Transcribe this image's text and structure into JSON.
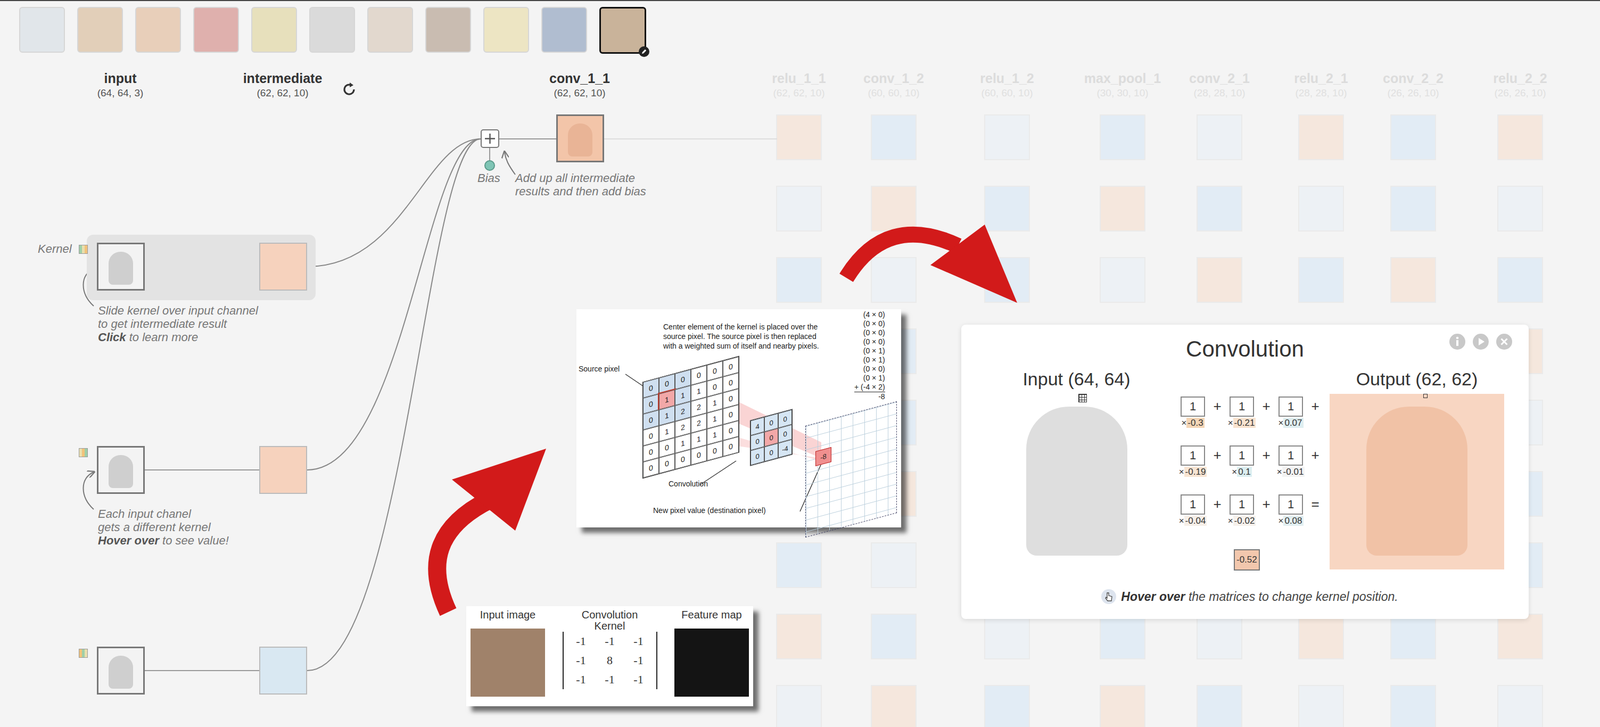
{
  "thumbnails": [
    {
      "selected": false
    },
    {
      "selected": false
    },
    {
      "selected": false
    },
    {
      "selected": false
    },
    {
      "selected": false
    },
    {
      "selected": false
    },
    {
      "selected": false
    },
    {
      "selected": false
    },
    {
      "selected": false
    },
    {
      "selected": false
    },
    {
      "selected": true
    }
  ],
  "layers": [
    {
      "name": "input",
      "shape": "(64, 64, 3)",
      "faded": false
    },
    {
      "name": "intermediate",
      "shape": "(62, 62, 10)",
      "faded": false
    },
    {
      "name": "conv_1_1",
      "shape": "(62, 62, 10)",
      "faded": false
    },
    {
      "name": "relu_1_1",
      "shape": "(62, 62, 10)",
      "faded": true
    },
    {
      "name": "conv_1_2",
      "shape": "(60, 60, 10)",
      "faded": true
    },
    {
      "name": "relu_1_2",
      "shape": "(60, 60, 10)",
      "faded": true
    },
    {
      "name": "max_pool_1",
      "shape": "(30, 30, 10)",
      "faded": true
    },
    {
      "name": "conv_2_1",
      "shape": "(28, 28, 10)",
      "faded": true
    },
    {
      "name": "relu_2_1",
      "shape": "(28, 28, 10)",
      "faded": true
    },
    {
      "name": "conv_2_2",
      "shape": "(26, 26, 10)",
      "faded": true
    },
    {
      "name": "relu_2_2",
      "shape": "(26, 26, 10)",
      "faded": true
    }
  ],
  "kernel_label": "Kernel",
  "kernel_rows": [
    {
      "highlighted": true,
      "color": "#f6d2bd"
    },
    {
      "highlighted": false,
      "color": "#f6d2bd"
    },
    {
      "highlighted": false,
      "color": "#d9e8f2"
    }
  ],
  "notes": [
    {
      "lines": [
        "Slide kernel over input channel",
        "to get intermediate result"
      ],
      "bold": "Click",
      "rest": " to learn more"
    },
    {
      "lines": [
        "Each input chanel",
        "gets a different kernel"
      ],
      "bold": "Hover over",
      "rest": " to see value!"
    }
  ],
  "bias": {
    "label": "Bias",
    "note": [
      "Add up all intermediate",
      "results and then add bias"
    ]
  },
  "panel": {
    "title": "Convolution",
    "input_label": "Input (64, 64)",
    "output_label": "Output (62, 62)",
    "cells": [
      {
        "value": "1",
        "times": "×",
        "weight": "-0.3",
        "color": "#f5d6b6",
        "op": "+"
      },
      {
        "value": "1",
        "times": "×",
        "weight": "-0.21",
        "color": "#f8e3cf",
        "op": "+"
      },
      {
        "value": "1",
        "times": "×",
        "weight": "0.07",
        "color": "#dfeef0",
        "op": "+"
      },
      {
        "value": "1",
        "times": "×",
        "weight": "-0.19",
        "color": "#f8e5d3",
        "op": "+"
      },
      {
        "value": "1",
        "times": "×",
        "weight": "0.1",
        "color": "#dceff1",
        "op": "+"
      },
      {
        "value": "1",
        "times": "×",
        "weight": "-0.01",
        "color": "#f3f3f3",
        "op": "+"
      },
      {
        "value": "1",
        "times": "×",
        "weight": "-0.04",
        "color": "#f6efe8",
        "op": "+"
      },
      {
        "value": "1",
        "times": "×",
        "weight": "-0.02",
        "color": "#f6f1ec",
        "op": "+"
      },
      {
        "value": "1",
        "times": "×",
        "weight": "0.08",
        "color": "#e2eff1",
        "op": "="
      }
    ],
    "result": "-0.52",
    "result_color": "#f2c7ad",
    "hint_bold": "Hover over",
    "hint_rest": " the matrices to change kernel position."
  },
  "figure1": {
    "caption": [
      "Center element of the kernel is placed over the",
      "source pixel. The source pixel is then replaced",
      "with a weighted sum of itself and nearby pixels."
    ],
    "source_label": "Source pixel",
    "conv_label": "Convolution",
    "dest_label": "New pixel value (destination pixel)",
    "sum_terms": [
      "(4 × 0)",
      "(0 × 0)",
      "(0 × 0)",
      "(0 × 0)",
      "(0 × 1)",
      "(0 × 1)",
      "(0 × 0)",
      "(0 × 1)",
      "+ (-4 × 2)"
    ],
    "sum_total": "-8",
    "source_grid": [
      [
        "0",
        "0",
        "0",
        "0",
        "0",
        "0"
      ],
      [
        "0",
        "1",
        "1",
        "1",
        "0",
        "0"
      ],
      [
        "0",
        "1",
        "2",
        "2",
        "1",
        "0"
      ],
      [
        "0",
        "1",
        "2",
        "2",
        "1",
        "0"
      ],
      [
        "0",
        "0",
        "1",
        "1",
        "1",
        "0"
      ],
      [
        "0",
        "0",
        "0",
        "0",
        "0",
        "0"
      ]
    ],
    "kernel": [
      [
        "4",
        "0",
        "0"
      ],
      [
        "0",
        "0",
        "0"
      ],
      [
        "0",
        "0",
        "-4"
      ]
    ],
    "output": "-8"
  },
  "figure2": {
    "input_label": "Input image",
    "kernel_label": [
      "Convolution",
      "Kernel"
    ],
    "output_label": "Feature map",
    "matrix": [
      [
        "-1",
        "-1",
        "-1"
      ],
      [
        "-1",
        "8",
        "-1"
      ],
      [
        "-1",
        "-1",
        "-1"
      ]
    ]
  }
}
